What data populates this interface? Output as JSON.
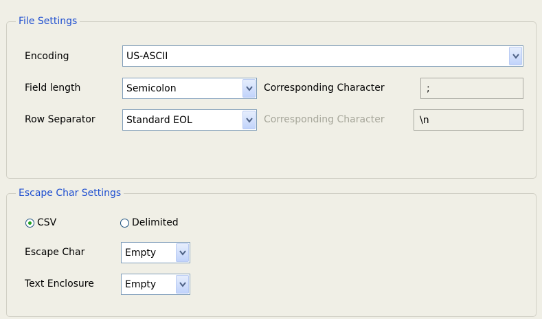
{
  "file_settings": {
    "title": "File Settings",
    "encoding": {
      "label": "Encoding",
      "value": "US-ASCII"
    },
    "field_length": {
      "label": "Field length",
      "value": "Semicolon",
      "corr_label": "Corresponding Character",
      "corr_value": ";"
    },
    "row_separator": {
      "label": "Row Separator",
      "value": "Standard EOL",
      "corr_label": "Corresponding Character",
      "corr_value": "\\n"
    }
  },
  "escape_settings": {
    "title": "Escape Char Settings",
    "radio_csv": {
      "label": "CSV",
      "selected": true
    },
    "radio_delimited": {
      "label": "Delimited",
      "selected": false
    },
    "escape_char": {
      "label": "Escape Char",
      "value": "Empty"
    },
    "text_enclosure": {
      "label": "Text Enclosure",
      "value": "Empty"
    }
  },
  "colors": {
    "group_title": "#1f4fd0",
    "background": "#f0efe6",
    "radio_selected": "#21a121"
  },
  "icons": {
    "dropdown": "chevron-down-icon",
    "radio": "radio-icon"
  }
}
